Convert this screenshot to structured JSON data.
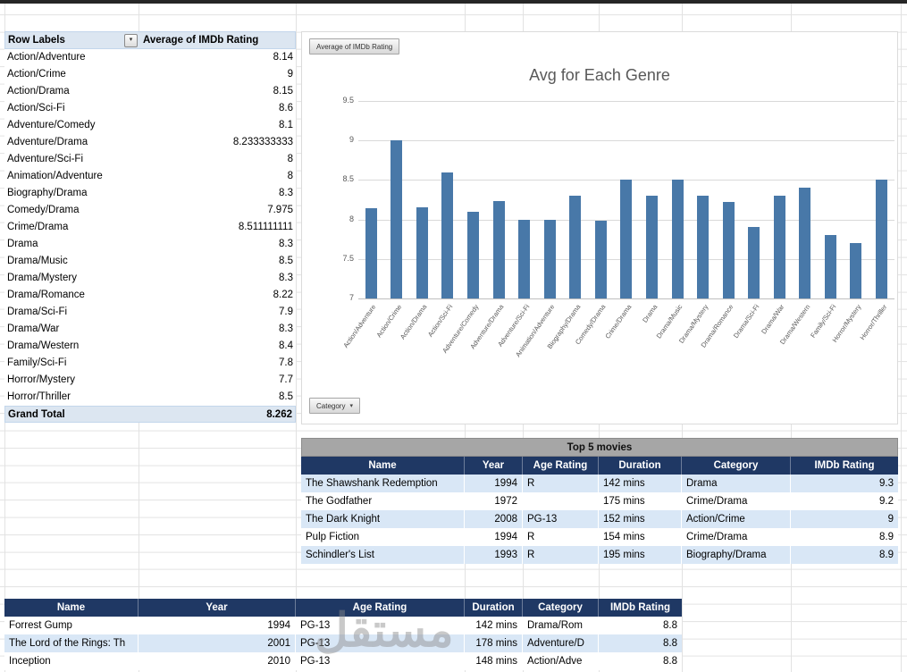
{
  "watermark": "مستقل",
  "icons": {
    "dropdown_caret": "▾"
  },
  "colors": {
    "header_navy": "#1F3864",
    "stripe_blue": "#D9E7F6",
    "pivot_blue": "#DCE6F1",
    "band_gray": "#A6A6A6",
    "title_gray": "#595959"
  },
  "pivot": {
    "header": {
      "row_labels": "Row Labels",
      "value": "Average of IMDb Rating"
    },
    "rows": [
      {
        "label": "Action/Adventure",
        "value": "8.14"
      },
      {
        "label": "Action/Crime",
        "value": "9"
      },
      {
        "label": "Action/Drama",
        "value": "8.15"
      },
      {
        "label": "Action/Sci-Fi",
        "value": "8.6"
      },
      {
        "label": "Adventure/Comedy",
        "value": "8.1"
      },
      {
        "label": "Adventure/Drama",
        "value": "8.233333333"
      },
      {
        "label": "Adventure/Sci-Fi",
        "value": "8"
      },
      {
        "label": "Animation/Adventure",
        "value": "8"
      },
      {
        "label": "Biography/Drama",
        "value": "8.3"
      },
      {
        "label": "Comedy/Drama",
        "value": "7.975"
      },
      {
        "label": "Crime/Drama",
        "value": "8.511111111"
      },
      {
        "label": "Drama",
        "value": "8.3"
      },
      {
        "label": "Drama/Music",
        "value": "8.5"
      },
      {
        "label": "Drama/Mystery",
        "value": "8.3"
      },
      {
        "label": "Drama/Romance",
        "value": "8.22"
      },
      {
        "label": "Drama/Sci-Fi",
        "value": "7.9"
      },
      {
        "label": "Drama/War",
        "value": "8.3"
      },
      {
        "label": "Drama/Western",
        "value": "8.4"
      },
      {
        "label": "Family/Sci-Fi",
        "value": "7.8"
      },
      {
        "label": "Horror/Mystery",
        "value": "7.7"
      },
      {
        "label": "Horror/Thriller",
        "value": "8.5"
      }
    ],
    "grand_total": {
      "label": "Grand Total",
      "value": "8.262"
    }
  },
  "chart": {
    "field_button": "Average of IMDb Rating",
    "axis_button": "Category"
  },
  "chart_data": {
    "type": "bar",
    "title": "Avg for Each Genre",
    "categories": [
      "Action/Adventure",
      "Action/Crime",
      "Action/Drama",
      "Action/Sci-Fi",
      "Adventure/Comedy",
      "Adventure/Drama",
      "Adventure/Sci-Fi",
      "Animation/Adventure",
      "Biography/Drama",
      "Comedy/Drama",
      "Crime/Drama",
      "Drama",
      "Drama/Music",
      "Drama/Mystery",
      "Drama/Romance",
      "Drama/Sci-Fi",
      "Drama/War",
      "Drama/Western",
      "Family/Sci-Fi",
      "Horror/Mystery",
      "Horror/Thriller"
    ],
    "values": [
      8.14,
      9,
      8.15,
      8.6,
      8.1,
      8.23,
      8,
      8,
      8.3,
      7.98,
      8.51,
      8.3,
      8.5,
      8.3,
      8.22,
      7.9,
      8.3,
      8.4,
      7.8,
      7.7,
      8.5
    ],
    "xlabel": "",
    "ylabel": "",
    "ylim": [
      7,
      9.5
    ],
    "yticks": [
      7,
      7.5,
      8,
      8.5,
      9,
      9.5
    ],
    "grid": true,
    "legend": "none",
    "bar_color": "#4878A8"
  },
  "top5": {
    "title": "Top 5 movies",
    "columns": [
      "Name",
      "Year",
      "Age Rating",
      "Duration",
      "Category",
      "IMDb Rating"
    ],
    "rows": [
      [
        "The Shawshank Redemption",
        "1994",
        "R",
        "142 mins",
        "Drama",
        "9.3"
      ],
      [
        "The Godfather",
        "1972",
        "",
        "175 mins",
        "Crime/Drama",
        "9.2"
      ],
      [
        "The Dark Knight",
        "2008",
        "PG-13",
        "152 mins",
        "Action/Crime",
        "9"
      ],
      [
        "Pulp Fiction",
        "1994",
        "R",
        "154 mins",
        "Crime/Drama",
        "8.9"
      ],
      [
        "Schindler's List",
        "1993",
        "R",
        "195 mins",
        "Biography/Drama",
        "8.9"
      ]
    ]
  },
  "bottom_table": {
    "columns": [
      "Name",
      "Year",
      "Age Rating",
      "Duration",
      "Category",
      "IMDb Rating"
    ],
    "rows": [
      [
        "Forrest Gump",
        "1994",
        "PG-13",
        "142 mins",
        "Drama/Rom",
        "8.8"
      ],
      [
        "The Lord of the Rings: Th",
        "2001",
        "PG-13",
        "178 mins",
        "Adventure/D",
        "8.8"
      ],
      [
        "Inception",
        "2010",
        "PG-13",
        "148 mins",
        "Action/Adve",
        "8.8"
      ]
    ]
  }
}
